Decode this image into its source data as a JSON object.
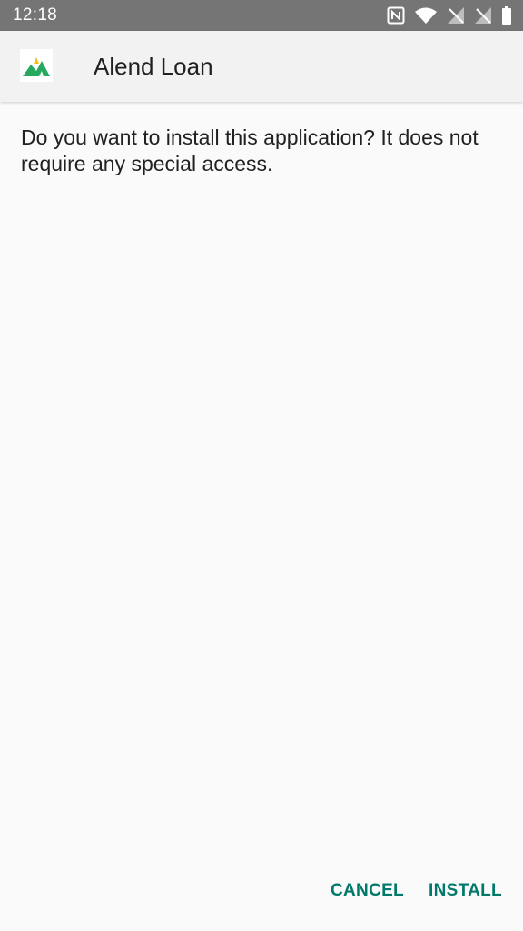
{
  "status_bar": {
    "time": "12:18",
    "icons": [
      "nfc-icon",
      "wifi-icon",
      "signal-off-icon",
      "signal-off-icon",
      "battery-icon"
    ]
  },
  "header": {
    "app_icon": "alend-loan-logo",
    "app_name": "Alend Loan"
  },
  "body": {
    "message": "Do you want to install this application? It does not require any special access."
  },
  "actions": {
    "cancel_label": "CANCEL",
    "install_label": "INSTALL"
  },
  "colors": {
    "status_bar": "#757575",
    "header_bg": "#f2f2f2",
    "page_bg": "#fafafa",
    "accent": "#00796b",
    "logo_green": "#26a85e",
    "logo_yellow": "#f4c20d"
  }
}
